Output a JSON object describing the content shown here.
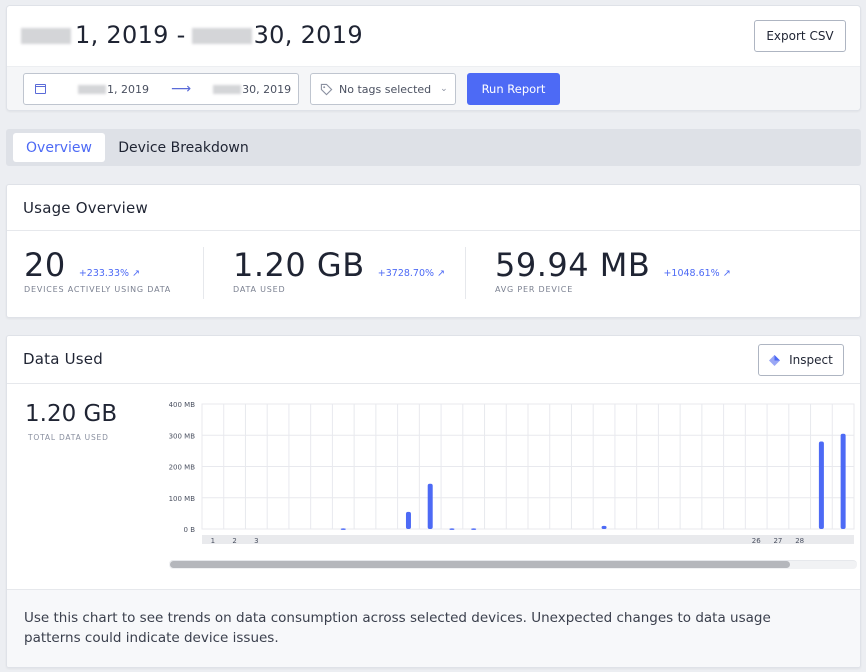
{
  "header": {
    "title_part1": "1, 2019 -",
    "title_part2": "30, 2019",
    "export_label": "Export CSV",
    "date_start": "1, 2019",
    "date_arrow": "⟶",
    "date_end": "30, 2019",
    "tags_label": "No tags selected",
    "run_label": "Run Report"
  },
  "tabs": [
    {
      "label": "Overview",
      "active": true
    },
    {
      "label": "Device Breakdown",
      "active": false
    }
  ],
  "usage_overview": {
    "title": "Usage Overview",
    "stats": [
      {
        "value": "20",
        "delta": "+233.33% ↗",
        "label": "DEVICES ACTIVELY USING DATA"
      },
      {
        "value": "1.20 GB",
        "delta": "+3728.70% ↗",
        "label": "DATA USED"
      },
      {
        "value": "59.94 MB",
        "delta": "+1048.61% ↗",
        "label": "AVG PER DEVICE"
      }
    ]
  },
  "data_used": {
    "title": "Data Used",
    "inspect_label": "Inspect",
    "total_value": "1.20 GB",
    "total_label": "TOTAL DATA USED",
    "footer_text": "Use this chart to see trends on data consumption across selected devices. Unexpected changes to data usage patterns could indicate device issues."
  },
  "colors": {
    "accent": "#4d6af5",
    "bar": "#4d6af5",
    "grid": "#e8e9ee"
  },
  "chart_data": {
    "type": "bar",
    "ylabel": "",
    "xlabel": "",
    "ylim": [
      0,
      400
    ],
    "y_ticks": [
      "0 B",
      "100 MB",
      "200 MB",
      "300 MB",
      "400 MB"
    ],
    "y_tick_values": [
      0,
      100,
      200,
      300,
      400
    ],
    "x_tick_labels": [
      "1",
      "2",
      "3",
      "",
      "",
      "",
      "",
      "",
      "",
      "",
      "",
      "",
      "",
      "",
      "",
      "",
      "",
      "",
      "",
      "",
      "",
      "",
      "",
      "",
      "",
      "26",
      "27",
      "28",
      "",
      ""
    ],
    "series": [
      {
        "values": [
          0,
          0,
          0,
          0,
          0,
          0,
          2,
          0,
          0,
          55,
          145,
          2,
          2,
          0,
          0,
          0,
          0,
          0,
          10,
          0,
          0,
          0,
          0,
          0,
          0,
          0,
          0,
          0,
          280,
          305
        ]
      }
    ],
    "grid": true
  }
}
